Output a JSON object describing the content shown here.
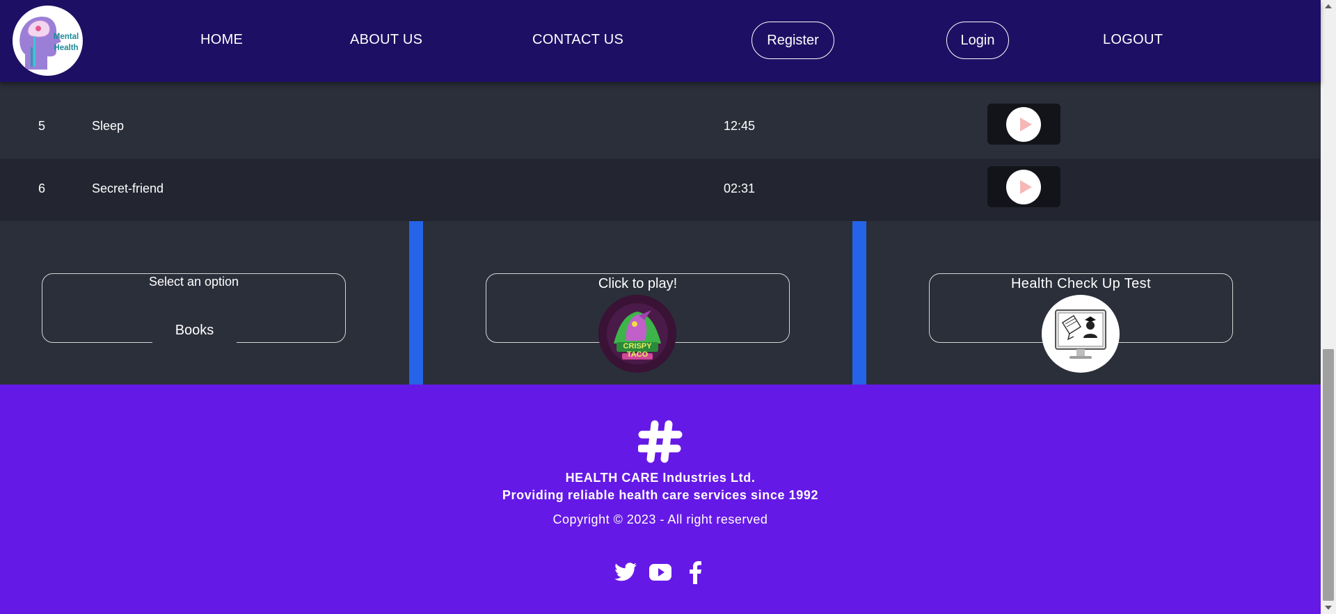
{
  "header": {
    "logo_text_small": "",
    "logo_text_main": "Mental Health",
    "nav": [
      {
        "label": "HOME"
      },
      {
        "label": "ABOUT US"
      },
      {
        "label": "CONTACT US"
      },
      {
        "label": "Register"
      },
      {
        "label": "Login"
      },
      {
        "label": "LOGOUT"
      }
    ]
  },
  "tracks": [
    {
      "num": "5",
      "name": "Sleep",
      "time": "12:45",
      "control": "play-icon"
    },
    {
      "num": "6",
      "name": "Secret-friend",
      "time": "02:31",
      "control": "play-icon"
    }
  ],
  "options": {
    "select": {
      "title": "Select an option",
      "selected": "Books"
    },
    "game": {
      "title": "Click to play!",
      "image_text": "CRISPY TACO"
    },
    "test": {
      "title": "Health Check Up Test"
    }
  },
  "footer": {
    "icon": "hashtag-icon",
    "company": "HEALTH CARE Industries Ltd.",
    "tagline": "Providing reliable health care services since 1992",
    "copyright": "Copyright © 2023 - All right reserved",
    "social": [
      "twitter-icon",
      "youtube-icon",
      "facebook-icon"
    ]
  },
  "colors": {
    "nav_bg": "#1d1064",
    "page_bg": "#2b2f3a",
    "divider": "#2563e8",
    "footer_bg": "#6519e6"
  }
}
